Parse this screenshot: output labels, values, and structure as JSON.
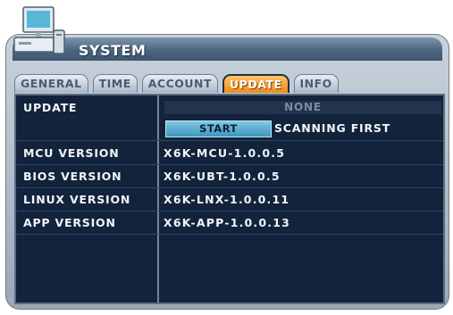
{
  "window": {
    "title": "SYSTEM",
    "icon": "computer-icon"
  },
  "tabs": [
    {
      "label": "GENERAL",
      "active": false
    },
    {
      "label": "TIME",
      "active": false
    },
    {
      "label": "ACCOUNT",
      "active": false
    },
    {
      "label": "UPDATE",
      "active": true
    },
    {
      "label": "INFO",
      "active": false
    }
  ],
  "update": {
    "label": "UPDATE",
    "status": "NONE",
    "start_label": "START",
    "mode": "SCANNING FIRST"
  },
  "versions": [
    {
      "label": "MCU VERSION",
      "value": "X6K-MCU-1.0.0.5"
    },
    {
      "label": "BIOS VERSION",
      "value": "X6K-UBT-1.0.0.5"
    },
    {
      "label": "LINUX VERSION",
      "value": "X6K-LNX-1.0.0.11"
    },
    {
      "label": "APP VERSION",
      "value": "X6K-APP-1.0.0.13"
    }
  ],
  "colors": {
    "panel": "#12233b",
    "active_tab": "#f08a18",
    "button": "#3f95bd"
  }
}
